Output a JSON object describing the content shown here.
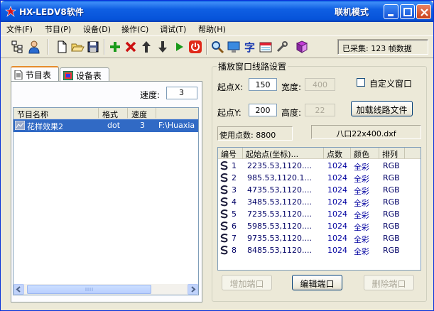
{
  "window": {
    "title": "HX-LEDV8软件",
    "mode": "联机模式"
  },
  "menu": [
    "文件(F)",
    "节目(P)",
    "设备(D)",
    "操作(C)",
    "调试(T)",
    "帮助(H)"
  ],
  "toolbar": {
    "collect_text": "已采集: 123 帧数据"
  },
  "left": {
    "tabs": [
      "节目表",
      "设备表"
    ],
    "speed_label": "速度:",
    "speed_value": "3",
    "columns": [
      "节目名称",
      "格式",
      "速度",
      ""
    ],
    "rows": [
      {
        "name": "花样效果2",
        "format": "dot",
        "speed": "3",
        "path": "F:\\Huaxia"
      }
    ]
  },
  "right": {
    "group_title": "播放窗口线路设置",
    "start_x_label": "起点X:",
    "start_x_value": "150",
    "width_label": "宽度:",
    "width_value": "400",
    "custom_window_label": "自定义窗口",
    "start_y_label": "起点Y:",
    "start_y_value": "200",
    "height_label": "高度:",
    "height_value": "22",
    "load_button": "加载线路文件",
    "points_label": "使用点数: 8800",
    "file_label": "八口22x400.dxf",
    "columns": [
      "编号",
      "起始点(坐标)...",
      "点数",
      "颜色",
      "排列"
    ],
    "rows": [
      {
        "id": "1",
        "start": "2235.53,1120....",
        "points": "1024",
        "color": "全彩",
        "order": "RGB"
      },
      {
        "id": "2",
        "start": "985.53,1120.1...",
        "points": "1024",
        "color": "全彩",
        "order": "RGB"
      },
      {
        "id": "3",
        "start": "4735.53,1120....",
        "points": "1024",
        "color": "全彩",
        "order": "RGB"
      },
      {
        "id": "4",
        "start": "3485.53,1120....",
        "points": "1024",
        "color": "全彩",
        "order": "RGB"
      },
      {
        "id": "5",
        "start": "7235.53,1120....",
        "points": "1024",
        "color": "全彩",
        "order": "RGB"
      },
      {
        "id": "6",
        "start": "5985.53,1120....",
        "points": "1024",
        "color": "全彩",
        "order": "RGB"
      },
      {
        "id": "7",
        "start": "9735.53,1120....",
        "points": "1024",
        "color": "全彩",
        "order": "RGB"
      },
      {
        "id": "8",
        "start": "8485.53,1120....",
        "points": "1024",
        "color": "全彩",
        "order": "RGB"
      }
    ],
    "add_port": "增加端口",
    "edit_port": "编辑端口",
    "delete_port": "删除端口"
  },
  "colors": {
    "titlebar": "#0653d9",
    "selection": "#316ac5",
    "dialog_bg": "#ece9d8"
  }
}
